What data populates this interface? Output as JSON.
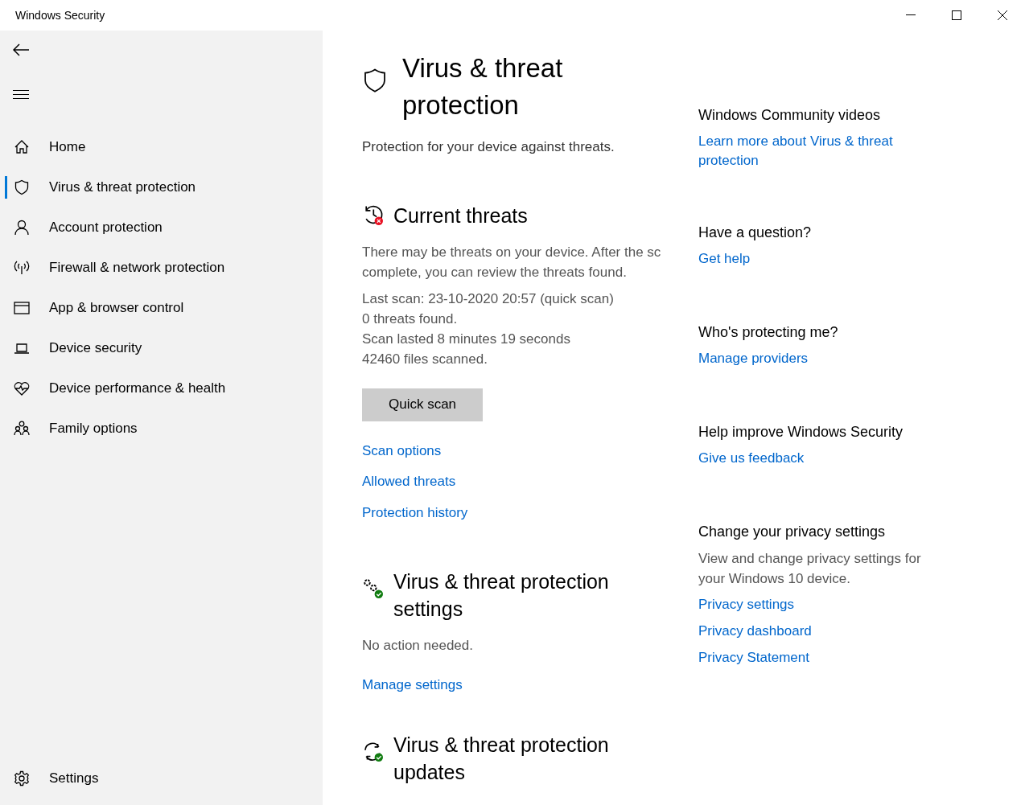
{
  "window": {
    "title": "Windows Security"
  },
  "nav": {
    "items": [
      {
        "label": "Home",
        "selected": false
      },
      {
        "label": "Virus & threat protection",
        "selected": true
      },
      {
        "label": "Account protection",
        "selected": false
      },
      {
        "label": "Firewall & network protection",
        "selected": false
      },
      {
        "label": "App & browser control",
        "selected": false
      },
      {
        "label": "Device security",
        "selected": false
      },
      {
        "label": "Device performance & health",
        "selected": false
      },
      {
        "label": "Family options",
        "selected": false
      }
    ],
    "settings": "Settings"
  },
  "page": {
    "title": "Virus & threat protection",
    "subtitle": "Protection for your device against threats."
  },
  "sections": [
    {
      "title": "Current threats",
      "color": "#e81123",
      "description": "There may be threats on your device. After the sc\ncomplete, you can review the threats found.",
      "details": [
        "Last scan: 23-10-2020 20:57 (quick scan)",
        "0 threats found.",
        "Scan lasted 8 minutes 19 seconds",
        "42460 files scanned."
      ],
      "button": "Quick scan",
      "links": [
        "Scan options",
        "Allowed threats",
        "Protection history"
      ]
    },
    {
      "title": "Virus & threat protection settings",
      "color": "#107c10",
      "description": "No action needed.",
      "links": [
        "Manage settings"
      ]
    },
    {
      "title": "Virus & threat protection updates",
      "color": "#107c10"
    }
  ],
  "aside": [
    {
      "title": "Windows Community videos",
      "links": [
        "Learn more about Virus & threat protection"
      ]
    },
    {
      "title": "Have a question?",
      "links": [
        "Get help"
      ]
    },
    {
      "title": "Who's protecting me?",
      "links": [
        "Manage providers"
      ]
    },
    {
      "title": "Help improve Windows Security",
      "links": [
        "Give us feedback"
      ]
    },
    {
      "title": "Change your privacy settings",
      "text": "View and change privacy settings for your Windows 10 device.",
      "links": [
        "Privacy settings",
        "Privacy dashboard",
        "Privacy Statement"
      ]
    }
  ]
}
